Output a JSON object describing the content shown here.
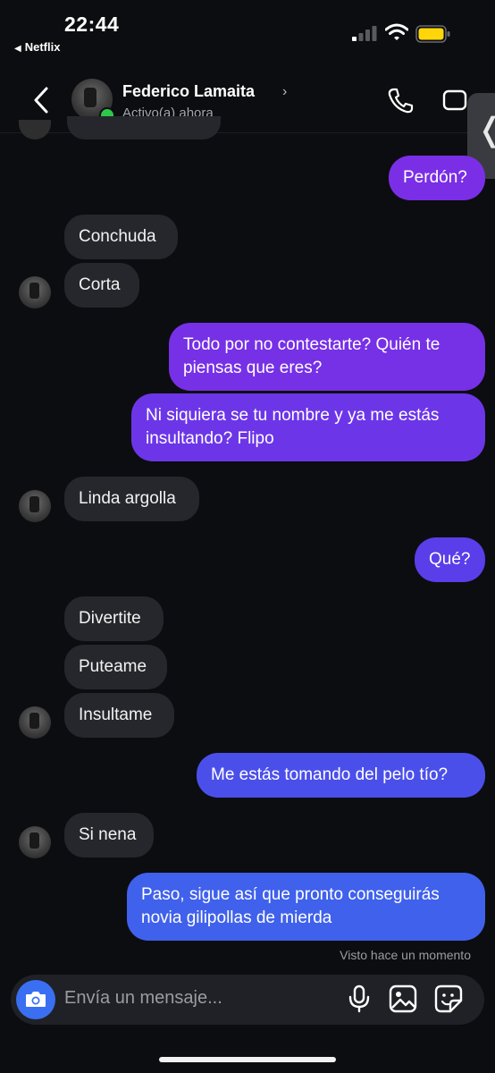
{
  "status_bar": {
    "time": "22:44",
    "back_app": "Netflix",
    "back_glyph": "◀"
  },
  "header": {
    "contact_name": "Federico Lamaita",
    "status": "Activo(a) ahora",
    "chevron": "›"
  },
  "colors": {
    "incoming": "#26272c",
    "online": "#2dc84a",
    "accent": "#3a6ff2"
  },
  "messages": [
    {
      "from": "me",
      "text": "Perdón?"
    },
    {
      "from": "them",
      "text": "Conchuda"
    },
    {
      "from": "them",
      "text": "Corta"
    },
    {
      "from": "me",
      "text": "Todo por no contestarte? Quién te piensas que eres?"
    },
    {
      "from": "me",
      "text": "Ni siquiera se tu nombre y ya me estás insultando? Flipo"
    },
    {
      "from": "them",
      "text": "Linda argolla"
    },
    {
      "from": "me",
      "text": "Qué?"
    },
    {
      "from": "them",
      "text": "Divertite"
    },
    {
      "from": "them",
      "text": "Puteame"
    },
    {
      "from": "them",
      "text": "Insultame"
    },
    {
      "from": "me",
      "text": "Me estás tomando del pelo tío?"
    },
    {
      "from": "them",
      "text": "Si nena"
    },
    {
      "from": "me",
      "text": "Paso, sigue así que pronto conseguirás novia gilipollas de mierda"
    }
  ],
  "seen_text": "Visto hace un momento",
  "composer": {
    "placeholder": "Envía un mensaje..."
  },
  "icons": {
    "back": "chevron-left-icon",
    "call": "phone-icon",
    "video": "video-camera-icon",
    "camera": "camera-icon",
    "mic": "microphone-icon",
    "gallery": "image-icon",
    "sticker": "sticker-icon",
    "side_tab": "chevron-left-icon"
  },
  "side_tab_glyph": "❬"
}
